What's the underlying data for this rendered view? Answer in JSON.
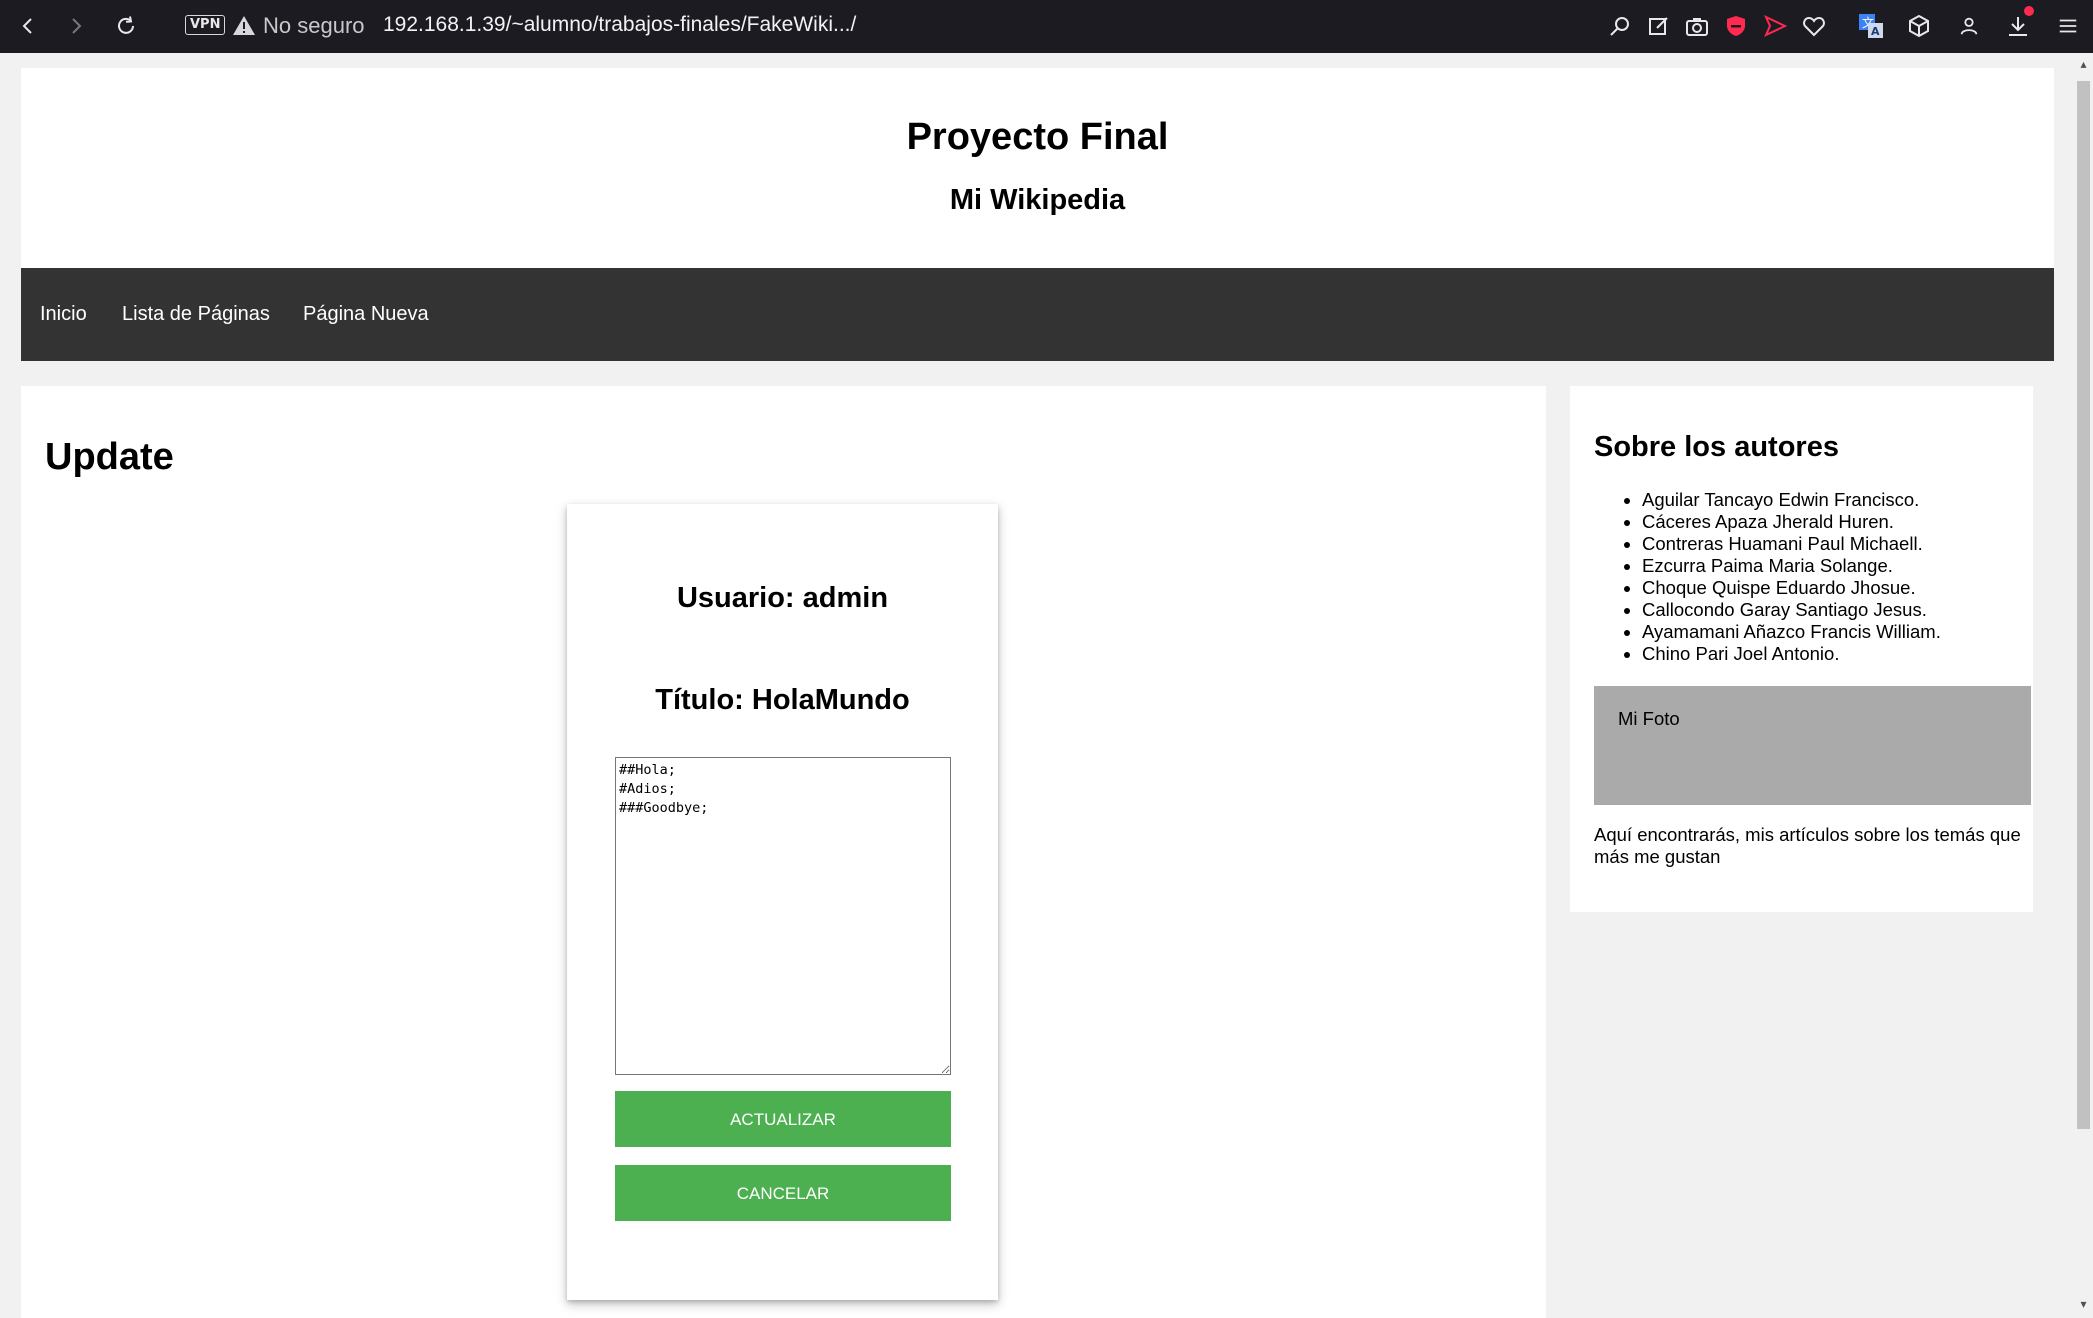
{
  "browser": {
    "vpn_label": "VPN",
    "security_text": "No seguro",
    "url": "192.168.1.39/~alumno/trabajos-finales/FakeWiki.../",
    "toolbar_icons": [
      "search-icon",
      "edit-icon",
      "camera-icon",
      "shield-icon",
      "send-icon",
      "heart-icon",
      "translate-icon",
      "cube-icon",
      "user-icon",
      "download-icon",
      "menu-icon"
    ],
    "colors": {
      "chrome_bg": "#1c1b22",
      "shield": "#ff2a4f",
      "send": "#ff2a4f",
      "translate": "#3b82f6"
    }
  },
  "header": {
    "title": "Proyecto Final",
    "subtitle": "Mi Wikipedia"
  },
  "topnav": {
    "items": [
      {
        "label": "Inicio"
      },
      {
        "label": "Lista de Páginas"
      },
      {
        "label": "Página Nueva"
      }
    ]
  },
  "main": {
    "heading": "Update",
    "form": {
      "usuario": "Usuario: admin",
      "titulo": "Título: HolaMundo",
      "content": "##Hola;\n#Adios;\n###Goodbye;",
      "update_button": "ACTUALIZAR",
      "cancel_button": "CANCELAR",
      "button_color": "#4caf50"
    }
  },
  "sidebar": {
    "heading": "Sobre los autores",
    "authors": [
      "Aguilar Tancayo Edwin Francisco.",
      "Cáceres Apaza Jherald Huren.",
      "Contreras Huamani Paul Michaell.",
      "Ezcurra Paima Maria Solange.",
      "Choque Quispe Eduardo Jhosue.",
      "Callocondo Garay Santiago Jesus.",
      "Ayamamani Añazco Francis William.",
      "Chino Pari Joel Antonio."
    ],
    "photo_label": "Mi Foto",
    "description": "Aquí encontrarás, mis artículos sobre los temás que más me gustan"
  }
}
